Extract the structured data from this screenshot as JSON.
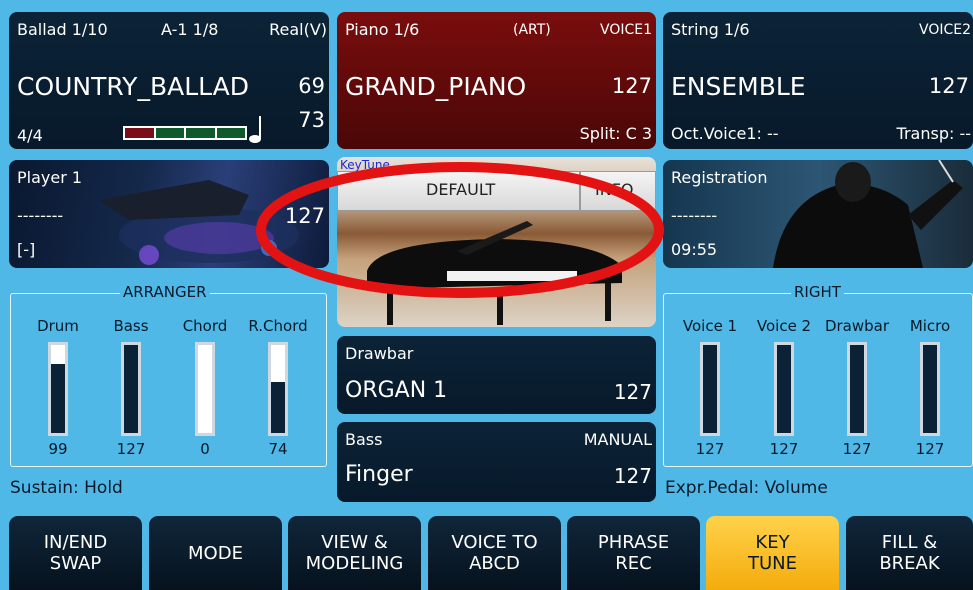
{
  "style_panel": {
    "style_number": "Ballad 1/10",
    "variation": "A-1 1/8",
    "mode": "Real(V)",
    "style_name": "COUNTRY_BALLAD",
    "value_top": "69",
    "value_bottom": "73",
    "time_signature": "4/4"
  },
  "voice1": {
    "bank": "Piano 1/6",
    "art": "(ART)",
    "slot": "VOICE1",
    "name": "GRAND_PIANO",
    "volume": "127",
    "split": "Split: C 3"
  },
  "voice2": {
    "bank": "String 1/6",
    "slot": "VOICE2",
    "name": "ENSEMBLE",
    "volume": "127",
    "oct": "Oct.Voice1: --",
    "transp": "Transp: --"
  },
  "player": {
    "title": "Player 1",
    "song": "--------",
    "value": "127",
    "state": "[-]"
  },
  "keytune": {
    "label": "KeyTune",
    "tab1": "DEFAULT",
    "tab2": "INFO"
  },
  "registration": {
    "title": "Registration",
    "name": "--------",
    "time": "09:55"
  },
  "arranger": {
    "title": "ARRANGER",
    "sliders": [
      {
        "label": "Drum",
        "value": "99",
        "level": 0.78
      },
      {
        "label": "Bass",
        "value": "127",
        "level": 1.0
      },
      {
        "label": "Chord",
        "value": "0",
        "level": 0.0
      },
      {
        "label": "R.Chord",
        "value": "74",
        "level": 0.58
      }
    ]
  },
  "right": {
    "title": "RIGHT",
    "sliders": [
      {
        "label": "Voice 1",
        "value": "127",
        "level": 1.0
      },
      {
        "label": "Voice 2",
        "value": "127",
        "level": 1.0
      },
      {
        "label": "Drawbar",
        "value": "127",
        "level": 1.0
      },
      {
        "label": "Micro",
        "value": "127",
        "level": 1.0
      }
    ]
  },
  "drawbar": {
    "title": "Drawbar",
    "name": "ORGAN 1",
    "value": "127"
  },
  "bass": {
    "title": "Bass",
    "mode": "MANUAL",
    "name": "Finger",
    "value": "127"
  },
  "status": {
    "sustain": "Sustain: Hold",
    "expr": "Expr.Pedal: Volume"
  },
  "buttons": [
    {
      "line1": "IN/END",
      "line2": "SWAP",
      "active": false
    },
    {
      "line1": "MODE",
      "line2": "",
      "active": false
    },
    {
      "line1": "VIEW &",
      "line2": "MODELING",
      "active": false
    },
    {
      "line1": "VOICE TO",
      "line2": "ABCD",
      "active": false
    },
    {
      "line1": "PHRASE",
      "line2": "REC",
      "active": false
    },
    {
      "line1": "KEY",
      "line2": "TUNE",
      "active": true
    },
    {
      "line1": "FILL &",
      "line2": "BREAK",
      "active": false
    }
  ],
  "colors": {
    "background": "#4fb8e6",
    "panel": "#0c2337",
    "voice1_panel": "#7a0d0d",
    "active_button": "#f4ac0d",
    "highlight_ellipse": "#e31313"
  }
}
